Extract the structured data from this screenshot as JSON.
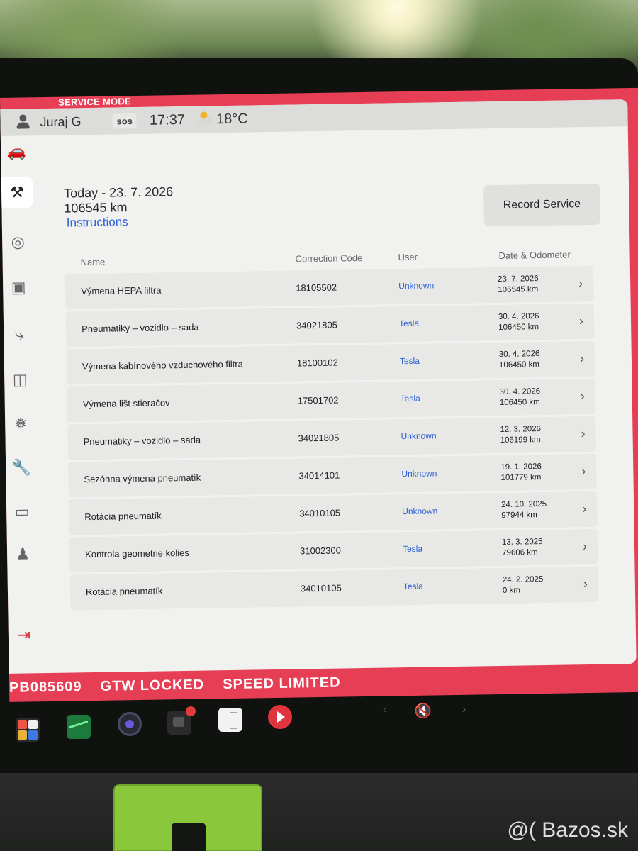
{
  "status_bar": {
    "mode_label": "SERVICE MODE",
    "user_name": "Juraj G",
    "sos_label": "sos",
    "time": "17:37",
    "temperature": "18°C"
  },
  "service": {
    "date_label": "Today - 23. 7. 2026",
    "odometer": "106545 km",
    "instructions_link": "Instructions",
    "record_button": "Record Service"
  },
  "table": {
    "headers": {
      "name": "Name",
      "code": "Correction Code",
      "user": "User",
      "date": "Date & Odometer"
    },
    "rows": [
      {
        "name": "Výmena HEPA filtra",
        "code": "18105502",
        "user": "Unknown",
        "date": "23. 7. 2026",
        "odometer": "106545 km"
      },
      {
        "name": "Pneumatiky – vozidlo – sada",
        "code": "34021805",
        "user": "Tesla",
        "date": "30. 4. 2026",
        "odometer": "106450 km"
      },
      {
        "name": "Výmena kabínového vzduchového filtra",
        "code": "18100102",
        "user": "Tesla",
        "date": "30. 4. 2026",
        "odometer": "106450 km"
      },
      {
        "name": "Výmena lišt stieračov",
        "code": "17501702",
        "user": "Tesla",
        "date": "30. 4. 2026",
        "odometer": "106450 km"
      },
      {
        "name": "Pneumatiky – vozidlo – sada",
        "code": "34021805",
        "user": "Unknown",
        "date": "12. 3. 2026",
        "odometer": "106199 km"
      },
      {
        "name": "Sezónna výmena pneumatík",
        "code": "34014101",
        "user": "Unknown",
        "date": "19. 1. 2026",
        "odometer": "101779 km"
      },
      {
        "name": "Rotácia pneumatík",
        "code": "34010105",
        "user": "Unknown",
        "date": "24. 10. 2025",
        "odometer": "97944 km"
      },
      {
        "name": "Kontrola geometrie kolies",
        "code": "31002300",
        "user": "Tesla",
        "date": "13. 3. 2025",
        "odometer": "79606 km"
      },
      {
        "name": "Rotácia pneumatík",
        "code": "34010105",
        "user": "Tesla",
        "date": "24. 2. 2025",
        "odometer": "0 km"
      }
    ]
  },
  "banner": {
    "vin_fragment": "PB085609",
    "gtw_status": "GTW LOCKED",
    "speed_status": "SPEED LIMITED"
  },
  "sidebar": {
    "icons": [
      "car-icon",
      "tools-icon",
      "steering-wheel-icon",
      "chip-icon",
      "lightning-icon",
      "battery-icon",
      "snowflake-icon",
      "wrench-icon",
      "door-icon",
      "seat-person-icon",
      "exit-icon"
    ]
  },
  "dock": {
    "icons": [
      "launcher-icon",
      "chart-icon",
      "camera-icon",
      "dashcam-icon",
      "notes-icon",
      "media-player-icon",
      "volume-muted-icon"
    ]
  },
  "watermark": "@( Bazos.sk",
  "colors": {
    "service_border": "#e63e55",
    "link_blue": "#2c63e0",
    "panel_bg": "#f1f1f0"
  }
}
